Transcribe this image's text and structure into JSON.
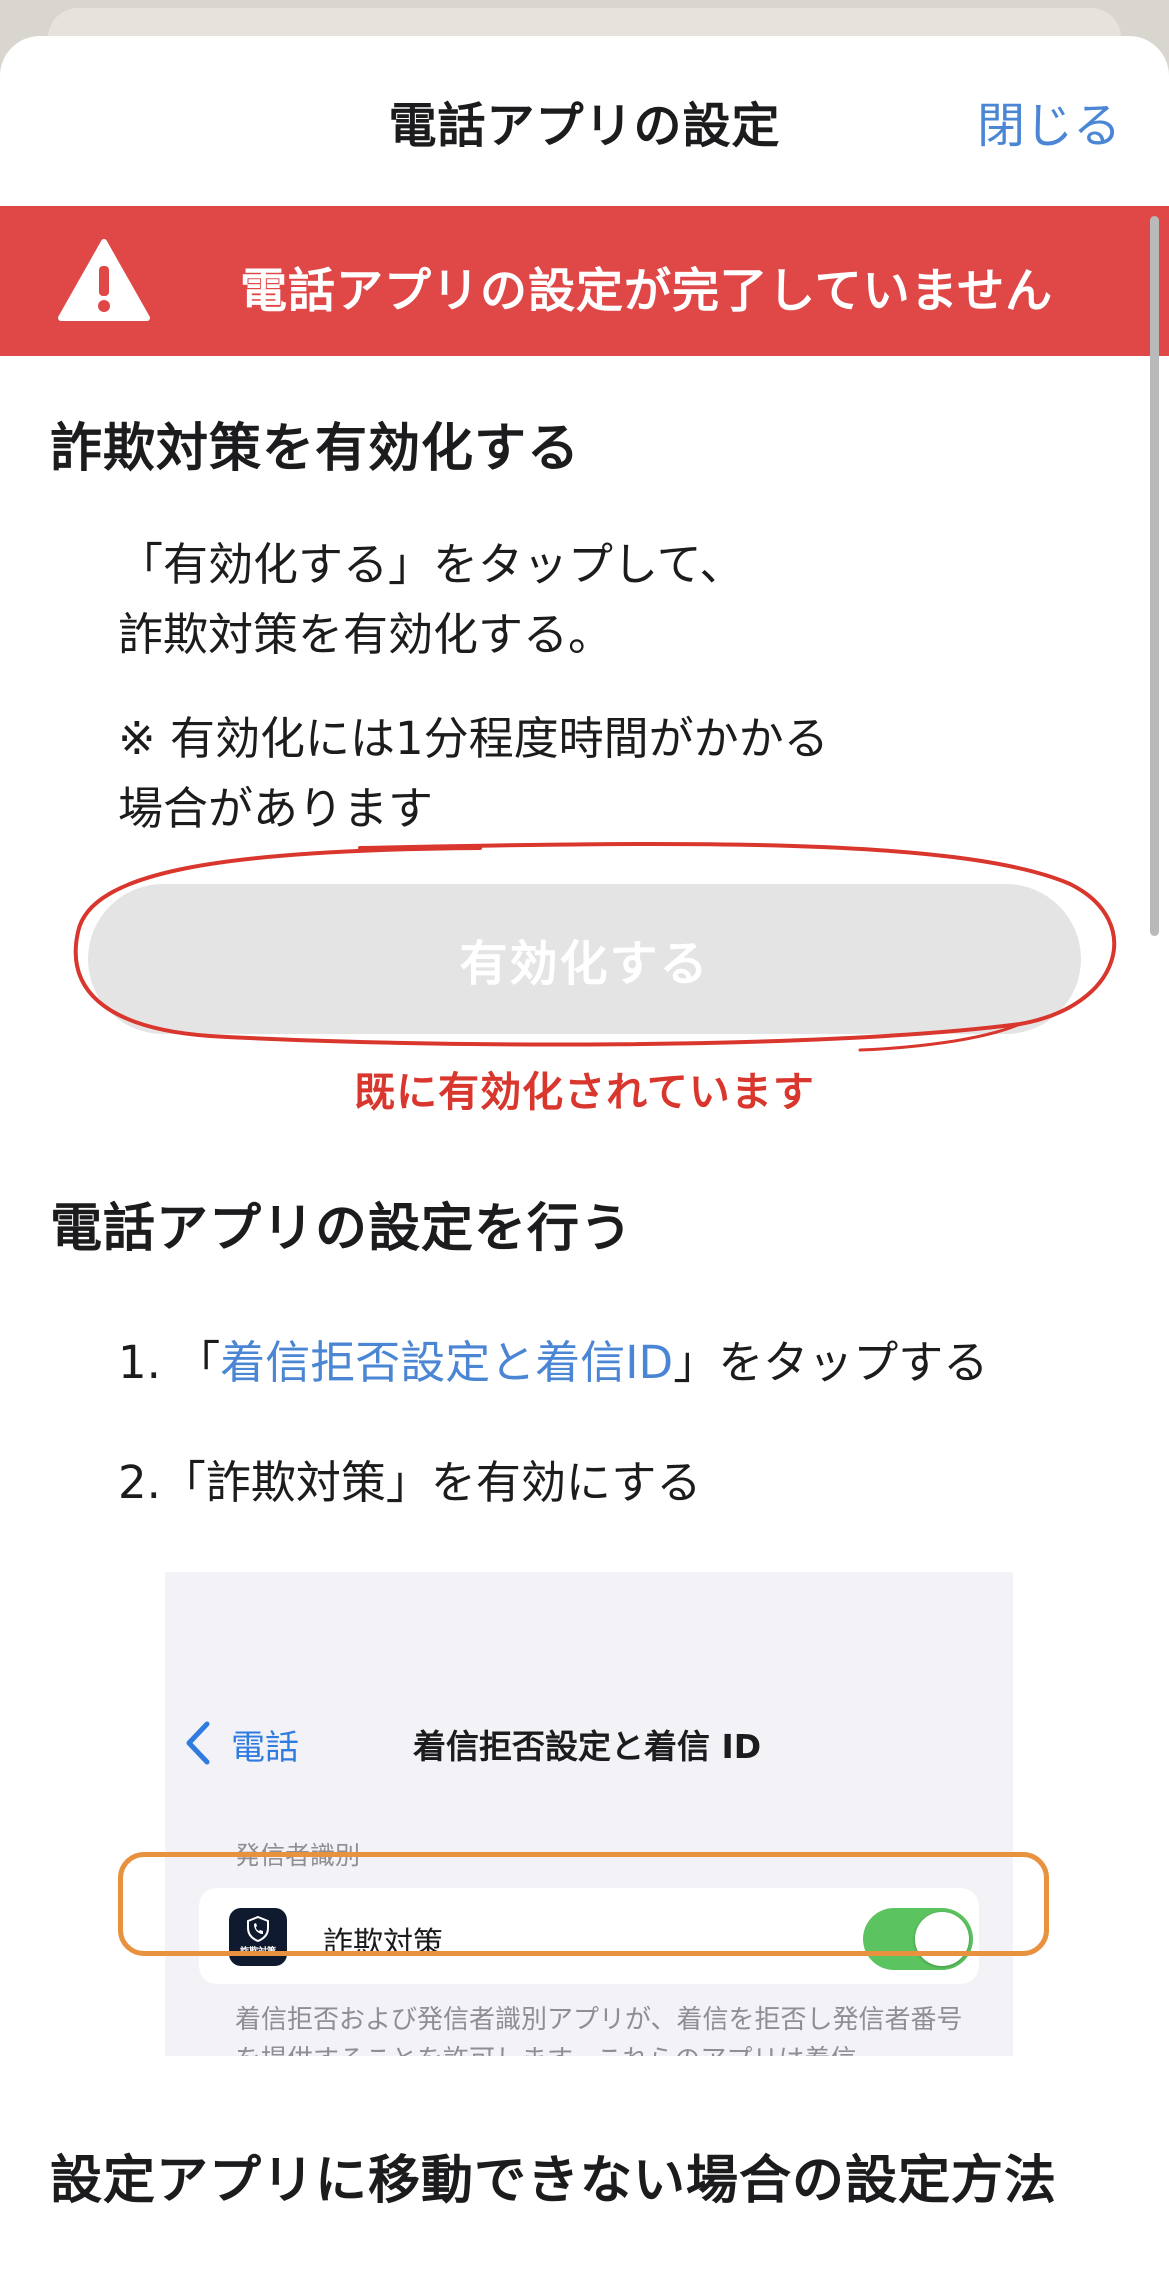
{
  "header": {
    "title": "電話アプリの設定",
    "close_label": "閉じる"
  },
  "warning": {
    "icon": "warning-triangle-icon",
    "text": "電話アプリの設定が完了していません",
    "color": "#e04848"
  },
  "section1": {
    "title": "詐欺対策を有効化する",
    "instruction_line1": "「有効化する」をタップして、",
    "instruction_line2": "詐欺対策を有効化する。",
    "note_line1": "※ 有効化には1分程度時間がかかる",
    "note_line2": "場合があります",
    "button_label": "有効化する",
    "annotation": "既に有効化されています"
  },
  "section2": {
    "title": "電話アプリの設定を行う",
    "step1_prefix": "1. 「",
    "step1_link": "着信拒否設定と着信ID",
    "step1_suffix": "」をタップする",
    "step2": "2.「詐欺対策」を有効にする"
  },
  "preview": {
    "back_label": "電話",
    "title": "着信拒否設定と着信 ID",
    "section_header": "発信者識別",
    "app_icon_label": "詐欺対策",
    "row_label": "詐欺対策",
    "toggle_on": true,
    "footer_text": "着信拒否および発信者識別アプリが、着信を拒否し発信者番号を提供することを許可します。これらのアプリは着信"
  },
  "section3": {
    "title": "設定アプリに移動できない場合の設定方法"
  },
  "colors": {
    "accent": "#4a86d4",
    "annotation_red": "#d9362d",
    "highlight_orange": "#e8913f",
    "toggle_green": "#5bc35f"
  }
}
